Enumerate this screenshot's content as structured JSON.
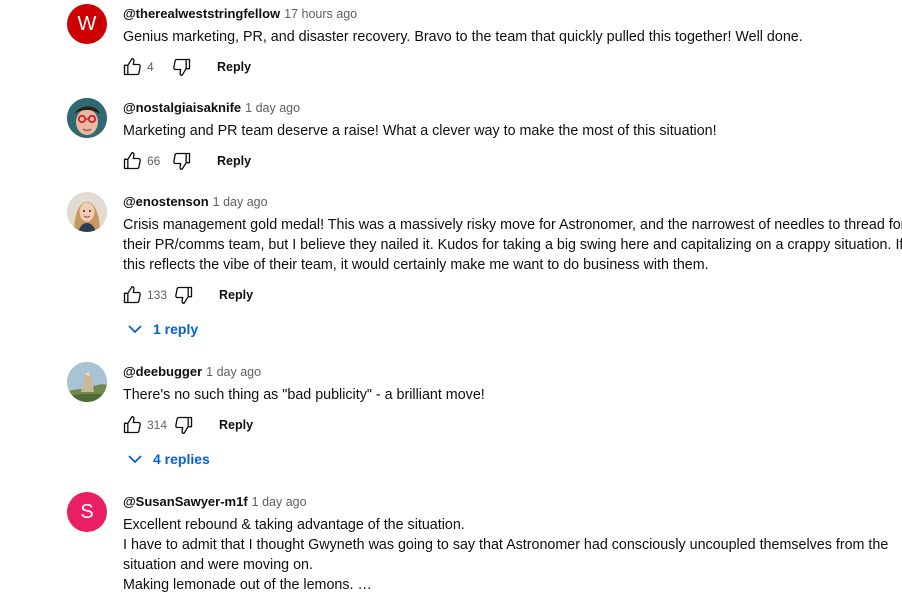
{
  "comments": [
    {
      "handle": "@therealweststringfellow",
      "time": "17 hours ago",
      "avatar": {
        "type": "letter",
        "letter": "W",
        "color": "#cc0000"
      },
      "lines": [
        "Genius marketing, PR, and disaster recovery. Bravo to the team that quickly pulled this together! Well done."
      ],
      "likes": "4",
      "reply_label": "Reply"
    },
    {
      "handle": "@nostalgiaisaknife",
      "time": "1 day ago",
      "avatar": {
        "type": "photo",
        "subject": "person-with-red-glasses"
      },
      "lines": [
        "Marketing and PR team deserve a raise! What a clever way to make the most of this situation!"
      ],
      "likes": "66",
      "reply_label": "Reply"
    },
    {
      "handle": "@enostenson",
      "time": "1 day ago",
      "avatar": {
        "type": "photo",
        "subject": "woman-portrait"
      },
      "lines": [
        "Crisis management gold medal! This was a massively risky move for Astronomer, and the narrowest of needles to thread for",
        "their PR/comms team, but I believe they nailed it. Kudos for taking a big swing here and capitalizing on a crappy situation. If",
        "this reflects the vibe of their team, it would certainly make me want to do business with them."
      ],
      "likes": "133",
      "reply_label": "Reply",
      "replies_label": "1 reply"
    },
    {
      "handle": "@deebugger",
      "time": "1 day ago",
      "avatar": {
        "type": "photo",
        "subject": "landscape-rock"
      },
      "lines": [
        "There's no such thing as \"bad publicity\" - a brilliant move!"
      ],
      "likes": "314",
      "reply_label": "Reply",
      "replies_label": "4 replies"
    },
    {
      "handle": "@SusanSawyer-m1f",
      "time": "1 day ago",
      "avatar": {
        "type": "letter",
        "letter": "S",
        "color": "#e91e63"
      },
      "lines": [
        "Excellent rebound & taking advantage of the situation.",
        "I have to admit that I thought Gwyneth was going to say that Astronomer had consciously uncoupled themselves from the",
        "situation and were moving on.",
        "Making lemonade out of the lemons. …"
      ]
    }
  ],
  "colors": {
    "link": "#065fd4",
    "meta": "#606060"
  }
}
